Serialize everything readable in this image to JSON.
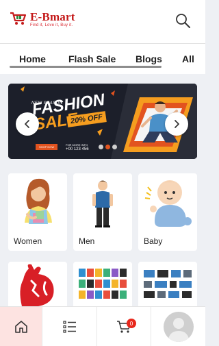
{
  "header": {
    "brand_name": "E-Bmart",
    "tagline": "Find it, Love it, Buy it.",
    "brand_color": "#c41a1a"
  },
  "tabs": [
    {
      "label": "Home"
    },
    {
      "label": "Flash Sale"
    },
    {
      "label": "Blogs"
    },
    {
      "label": "All"
    }
  ],
  "banner": {
    "small_text": "NEW SEASON",
    "title_line1": "FASHION",
    "title_line2": "SALE",
    "discount": "20% OFF",
    "shop_button": "SHOP NOW",
    "contact_label": "FOR MORE INFO",
    "phone": "+00 123 456",
    "accent_color": "#f59d1f"
  },
  "categories": [
    {
      "label": "Women"
    },
    {
      "label": "Men"
    },
    {
      "label": "Baby"
    },
    {
      "label": ""
    },
    {
      "label": ""
    },
    {
      "label": ""
    }
  ],
  "bottom_nav": {
    "items": [
      {
        "icon": "home-icon",
        "active": true
      },
      {
        "icon": "list-icon"
      },
      {
        "icon": "cart-icon",
        "badge": "0"
      },
      {
        "icon": "avatar"
      }
    ],
    "active_bg": "#fde3e1",
    "badge_color": "#e8281c"
  }
}
